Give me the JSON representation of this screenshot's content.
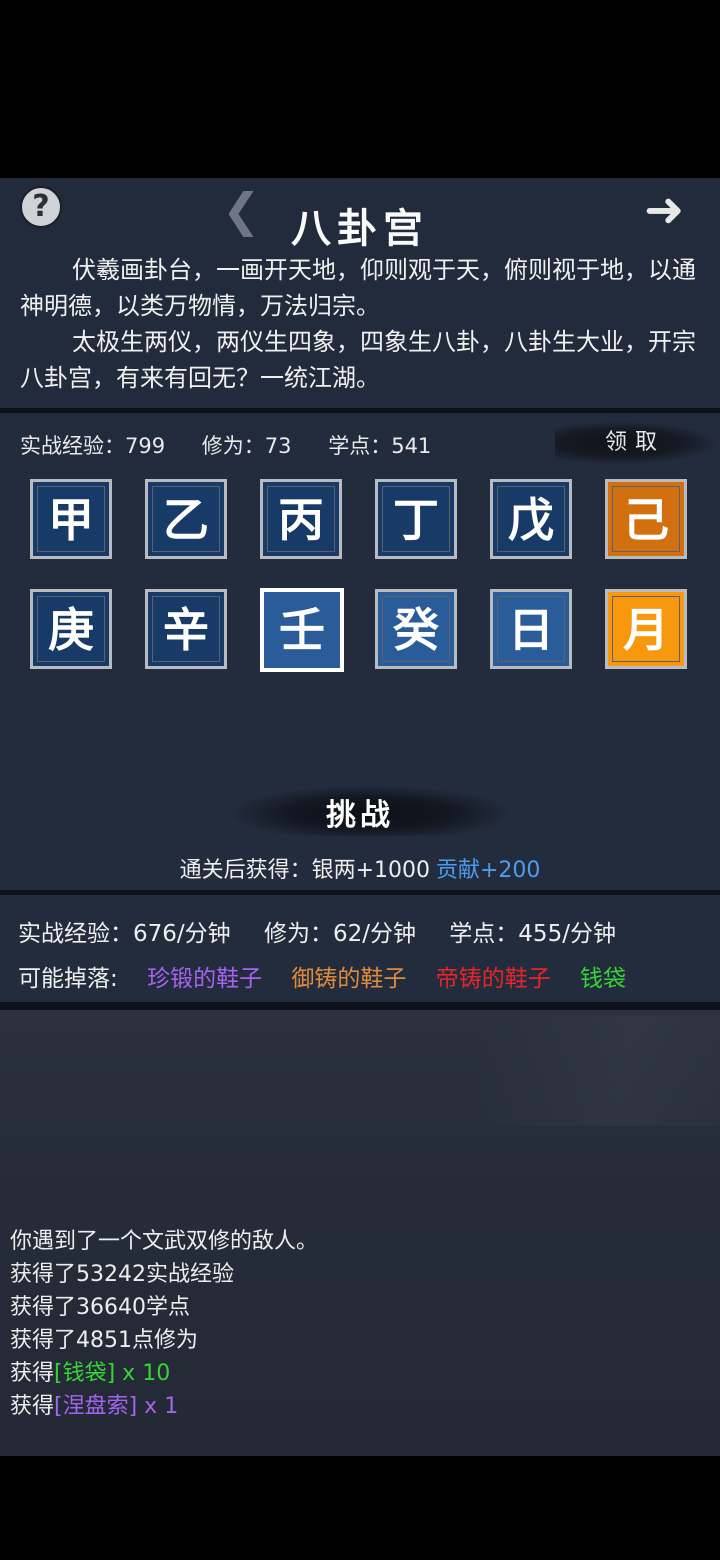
{
  "header": {
    "help_glyph": "?",
    "back_glyph": "❮",
    "next_glyph": "➜",
    "title": "八卦宫"
  },
  "intro": {
    "para1": "伏羲画卦台，一画开天地，仰则观于天，俯则视于地，以通神明德，以类万物情，万法归宗。",
    "para2": "太极生两仪，两仪生四象，四象生八卦，八卦生大业，开宗八卦宫，有来有回无？一统江湖。"
  },
  "stats": {
    "combat_exp": "实战经验：799",
    "cultivation": "修为：73",
    "study": "学点：541",
    "claim_label": "领取"
  },
  "tiles": [
    {
      "char": "甲",
      "style": "blue"
    },
    {
      "char": "乙",
      "style": "blue"
    },
    {
      "char": "丙",
      "style": "blue"
    },
    {
      "char": "丁",
      "style": "blue"
    },
    {
      "char": "戊",
      "style": "blue"
    },
    {
      "char": "己",
      "style": "orange-dark"
    },
    {
      "char": "庚",
      "style": "blue"
    },
    {
      "char": "辛",
      "style": "blue"
    },
    {
      "char": "壬",
      "style": "selected"
    },
    {
      "char": "癸",
      "style": "mid-blue"
    },
    {
      "char": "日",
      "style": "mid-blue"
    },
    {
      "char": "月",
      "style": "orange-bright"
    }
  ],
  "challenge": {
    "label": "挑战",
    "reward_prefix": "通关后获得：银两+1000",
    "reward_contrib": "贡献+200"
  },
  "rates": {
    "combat_exp": "实战经验：676/分钟",
    "cultivation": "修为：62/分钟",
    "study": "学点：455/分钟"
  },
  "drops": {
    "label": "可能掉落:",
    "items": [
      {
        "name": "珍锻的鞋子",
        "color": "#a463f0"
      },
      {
        "name": "御铸的鞋子",
        "color": "#e08a3c"
      },
      {
        "name": "帝铸的鞋子",
        "color": "#e3262a"
      },
      {
        "name": "钱袋",
        "color": "#36d436"
      }
    ]
  },
  "log": {
    "line1": "你遇到了一个文武双修的敌人。",
    "line2": "获得了53242实战经验",
    "line3": "获得了36640学点",
    "line4": "获得了4851点修为",
    "line5_prefix": "获得",
    "line5_item": "[钱袋]",
    "line5_qty": " x 10",
    "line6_prefix": "获得",
    "line6_item": "[涅盘索]",
    "line6_qty": " x 1"
  },
  "colors": {
    "tile_blue": "#173a66",
    "tile_mid_blue": "#2b5c9a",
    "tile_orange_dark": "#d27010",
    "tile_orange_bright": "#f7980e",
    "contrib": "#4d9cf0",
    "green": "#36d436",
    "purple": "#a463f0"
  }
}
